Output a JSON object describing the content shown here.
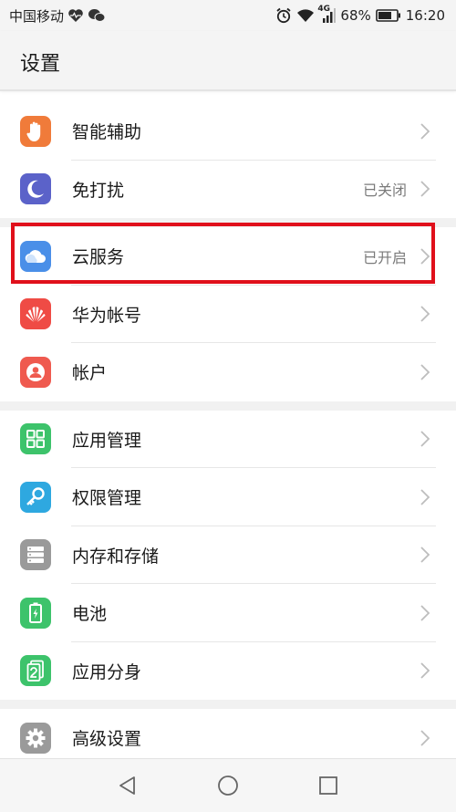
{
  "status_bar": {
    "carrier": "中国移动",
    "network": "4G",
    "battery": "68%",
    "time": "16:20"
  },
  "header": {
    "title": "设置"
  },
  "settings": {
    "smart_assist": {
      "label": "智能辅助"
    },
    "dnd": {
      "label": "免打扰",
      "value": "已关闭"
    },
    "cloud": {
      "label": "云服务",
      "value": "已开启"
    },
    "huawei_account": {
      "label": "华为帐号"
    },
    "accounts": {
      "label": "帐户"
    },
    "app_manager": {
      "label": "应用管理"
    },
    "permissions": {
      "label": "权限管理"
    },
    "storage": {
      "label": "内存和存储"
    },
    "battery": {
      "label": "电池"
    },
    "app_twin": {
      "label": "应用分身"
    },
    "advanced": {
      "label": "高级设置"
    }
  },
  "colors": {
    "highlight": "#e0101b",
    "smart_assist": "#f07b3a",
    "dnd": "#5b62c9",
    "cloud": "#4a8fe8",
    "huawei": "#ef4b45",
    "accounts": "#ef5a4f",
    "green": "#3dc36b",
    "teal": "#2ea8e0",
    "gray": "#9a9a9a"
  }
}
